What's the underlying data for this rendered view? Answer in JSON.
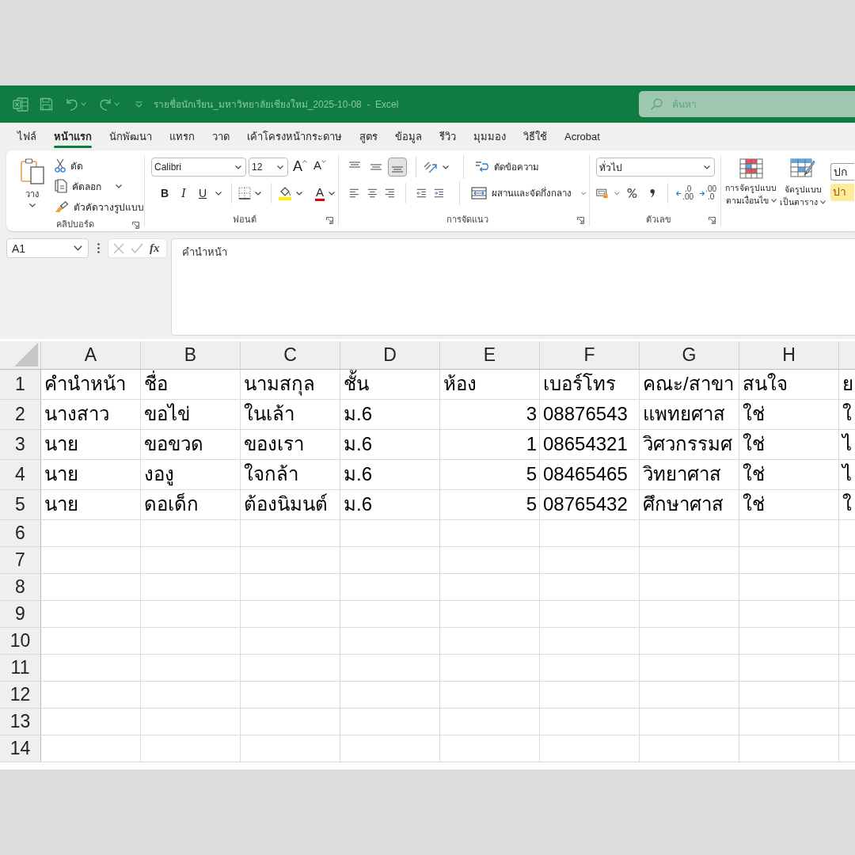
{
  "window": {
    "title": "รายชื่อนักเรียน_มหาวิทยาลัยเชียงใหม่_2025-10-08  -  Excel"
  },
  "search": {
    "placeholder": "ค้นหา"
  },
  "tabs": [
    {
      "label": "ไฟล์",
      "selected": false
    },
    {
      "label": "หน้าแรก",
      "selected": true
    },
    {
      "label": "นักพัฒนา",
      "selected": false
    },
    {
      "label": "แทรก",
      "selected": false
    },
    {
      "label": "วาด",
      "selected": false
    },
    {
      "label": "เค้าโครงหน้ากระดาษ",
      "selected": false
    },
    {
      "label": "สูตร",
      "selected": false
    },
    {
      "label": "ข้อมูล",
      "selected": false
    },
    {
      "label": "รีวิว",
      "selected": false
    },
    {
      "label": "มุมมอง",
      "selected": false
    },
    {
      "label": "วิธีใช้",
      "selected": false
    },
    {
      "label": "Acrobat",
      "selected": false
    }
  ],
  "ribbon": {
    "clipboard": {
      "label": "คลิปบอร์ด",
      "paste": "วาง",
      "cut": "ตัด",
      "copy": "คัดลอก",
      "format_painter": "ตัวคัดวางรูปแบบ"
    },
    "font": {
      "label": "ฟอนต์",
      "name": "Calibri",
      "size": "12",
      "grow": "A",
      "shrink": "A",
      "bold": "B",
      "italic": "I",
      "underline": "U",
      "color_letter": "A"
    },
    "alignment": {
      "label": "การจัดแนว",
      "vertical": [
        {
          "selected": false
        },
        {
          "selected": false
        },
        {
          "selected": true
        }
      ],
      "wrap_text": "ตัดข้อความ",
      "merge": "ผสานและจัดกึ่งกลาง"
    },
    "number": {
      "label": "ตัวเลข",
      "format": "ทั่วไป",
      "decimal_buttons": [
        {
          "top": ".0",
          "bottom": ".00"
        },
        {
          "top": ".00",
          "bottom": ".0"
        }
      ]
    },
    "styles": {
      "buttons": [
        {
          "lines": [
            "การจัดรูปแบบ",
            "ตามเงื่อนไข"
          ]
        },
        {
          "lines": [
            "จัดรูปแบบ",
            "เป็นตาราง"
          ]
        }
      ],
      "gallery": [
        {
          "text": "ปก",
          "kind": "normal"
        },
        {
          "text": "ปา",
          "kind": "neutral"
        }
      ]
    }
  },
  "formula_bar": {
    "cell": "A1",
    "function_label": "fx",
    "value": "คำนำหน้า"
  },
  "sheet": {
    "columns": [
      "A",
      "B",
      "C",
      "D",
      "E",
      "F",
      "G",
      "H"
    ],
    "rows": [
      {
        "number": "1",
        "cells": [
          {
            "text": "คำนำหน้า",
            "kind": "text"
          },
          {
            "text": "ชื่อ",
            "kind": "text"
          },
          {
            "text": "นามสกุล",
            "kind": "text"
          },
          {
            "text": "ชั้น",
            "kind": "text"
          },
          {
            "text": "ห้อง",
            "kind": "text"
          },
          {
            "text": "เบอร์โทร",
            "kind": "text"
          },
          {
            "text": "คณะ/สาขา",
            "kind": "text"
          },
          {
            "text": "สนใจ",
            "kind": "text"
          },
          {
            "text": "ย",
            "kind": "text"
          }
        ]
      },
      {
        "number": "2",
        "cells": [
          {
            "text": "นางสาว",
            "kind": "text"
          },
          {
            "text": "ขอไข่",
            "kind": "text"
          },
          {
            "text": "ในเล้า",
            "kind": "text"
          },
          {
            "text": "ม.6",
            "kind": "text"
          },
          {
            "text": "3",
            "kind": "number"
          },
          {
            "text": "08876543",
            "kind": "text"
          },
          {
            "text": "แพทยศาส",
            "kind": "text"
          },
          {
            "text": "ใช่",
            "kind": "text"
          },
          {
            "text": "ใ",
            "kind": "text"
          }
        ]
      },
      {
        "number": "3",
        "cells": [
          {
            "text": "นาย",
            "kind": "text"
          },
          {
            "text": "ขอขวด",
            "kind": "text"
          },
          {
            "text": "ของเรา",
            "kind": "text"
          },
          {
            "text": "ม.6",
            "kind": "text"
          },
          {
            "text": "1",
            "kind": "number"
          },
          {
            "text": "08654321",
            "kind": "text"
          },
          {
            "text": "วิศวกรรมศ",
            "kind": "text"
          },
          {
            "text": "ใช่",
            "kind": "text"
          },
          {
            "text": "ไ",
            "kind": "text"
          }
        ]
      },
      {
        "number": "4",
        "cells": [
          {
            "text": "นาย",
            "kind": "text"
          },
          {
            "text": "งองู",
            "kind": "text"
          },
          {
            "text": "ใจกล้า",
            "kind": "text"
          },
          {
            "text": "ม.6",
            "kind": "text"
          },
          {
            "text": "5",
            "kind": "number"
          },
          {
            "text": "08465465",
            "kind": "text"
          },
          {
            "text": "วิทยาศาส",
            "kind": "text"
          },
          {
            "text": "ใช่",
            "kind": "text"
          },
          {
            "text": "ไ",
            "kind": "text"
          }
        ]
      },
      {
        "number": "5",
        "cells": [
          {
            "text": "นาย",
            "kind": "text"
          },
          {
            "text": "ดอเด็ก",
            "kind": "text"
          },
          {
            "text": "ต้องนิมนต์",
            "kind": "text"
          },
          {
            "text": "ม.6",
            "kind": "text"
          },
          {
            "text": "5",
            "kind": "number"
          },
          {
            "text": "08765432",
            "kind": "text"
          },
          {
            "text": "ศึกษาศาส",
            "kind": "text"
          },
          {
            "text": "ใช่",
            "kind": "text"
          },
          {
            "text": "ใ",
            "kind": "text"
          }
        ]
      },
      {
        "number": "6"
      },
      {
        "number": "7"
      },
      {
        "number": "8"
      },
      {
        "number": "9"
      },
      {
        "number": "10"
      },
      {
        "number": "11"
      },
      {
        "number": "12"
      },
      {
        "number": "13"
      },
      {
        "number": "14"
      }
    ]
  }
}
